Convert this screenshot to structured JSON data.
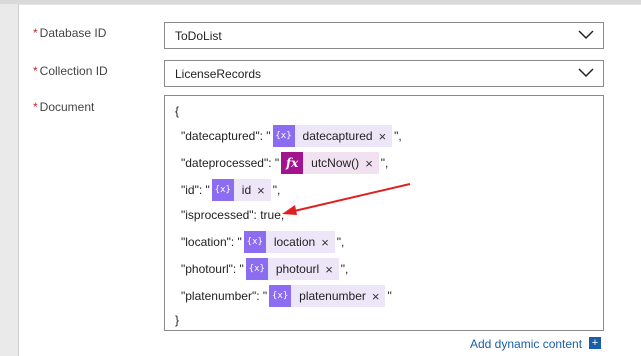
{
  "fields": {
    "database": {
      "label": "Database ID",
      "value": "ToDoList"
    },
    "collection": {
      "label": "Collection ID",
      "value": "LicenseRecords"
    },
    "document": {
      "label": "Document"
    }
  },
  "required_mark": "*",
  "document": {
    "open_brace": "{",
    "close_brace": "}",
    "lines": [
      {
        "key": "\"datecaptured\": \"",
        "token": "datecaptured",
        "token_type": "dynamic",
        "suffix": "\","
      },
      {
        "key": "\"dateprocessed\": \"",
        "token": "utcNow()",
        "token_type": "expression",
        "suffix": "\","
      },
      {
        "key": "\"id\": \"",
        "token": "id",
        "token_type": "dynamic",
        "suffix": "\","
      },
      {
        "key": "\"isprocessed\": true,",
        "token": null,
        "suffix": ""
      },
      {
        "key": "\"location\": \"",
        "token": "location",
        "token_type": "dynamic",
        "suffix": "\","
      },
      {
        "key": "\"photourl\": \"",
        "token": "photourl",
        "token_type": "dynamic",
        "suffix": "\","
      },
      {
        "key": "\"platenumber\": \"",
        "token": "platenumber",
        "token_type": "dynamic",
        "suffix": "\""
      }
    ]
  },
  "token_icons": {
    "dynamic": "{x}",
    "expression": "fx"
  },
  "token_close": "×",
  "add_dynamic_content": "Add dynamic content",
  "add_plus": "+",
  "colors": {
    "dynamic_icon": "#8c6cf0",
    "expression_icon": "#a3138f",
    "annotation_arrow": "#e02020",
    "link": "#1a5ea8",
    "required": "#c4262e"
  }
}
